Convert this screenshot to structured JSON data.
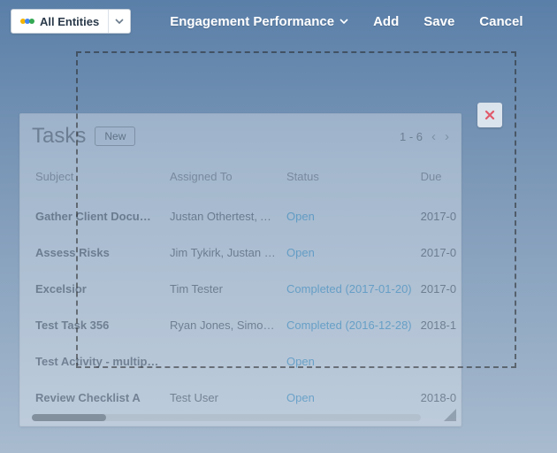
{
  "header": {
    "entity_label": "All Entities",
    "tabs": [
      {
        "label": "Engagement Performance",
        "has_dropdown": true
      },
      {
        "label": "Add"
      },
      {
        "label": "Save"
      },
      {
        "label": "Cancel"
      }
    ]
  },
  "panel": {
    "title": "Tasks",
    "new_label": "New",
    "pager_text": "1 - 6",
    "columns": [
      "Subject",
      "Assigned To",
      "Status",
      "Due"
    ],
    "rows": [
      {
        "subject": "Gather Client Documen..",
        "assigned": "Justan Othertest, Abc..",
        "status": "Open",
        "due": "2017-0"
      },
      {
        "subject": "Assess Risks",
        "assigned": "Jim Tykirk, Justan Oth..",
        "status": "Open",
        "due": "2017-0"
      },
      {
        "subject": "Excelsior",
        "assigned": "Tim Tester",
        "status": "Completed (2017-01-20)",
        "due": "2017-0"
      },
      {
        "subject": "Test Task 356",
        "assigned": "Ryan Jones, Simon Ho..",
        "status": "Completed (2016-12-28)",
        "due": "2018-1"
      },
      {
        "subject": "Test Activity - multiple ..",
        "assigned": "",
        "status": "Open",
        "due": ""
      },
      {
        "subject": "Review Checklist A",
        "assigned": "Test User",
        "status": "Open",
        "due": "2018-0"
      }
    ]
  },
  "colors": {
    "close_x": "#e05a6b"
  }
}
